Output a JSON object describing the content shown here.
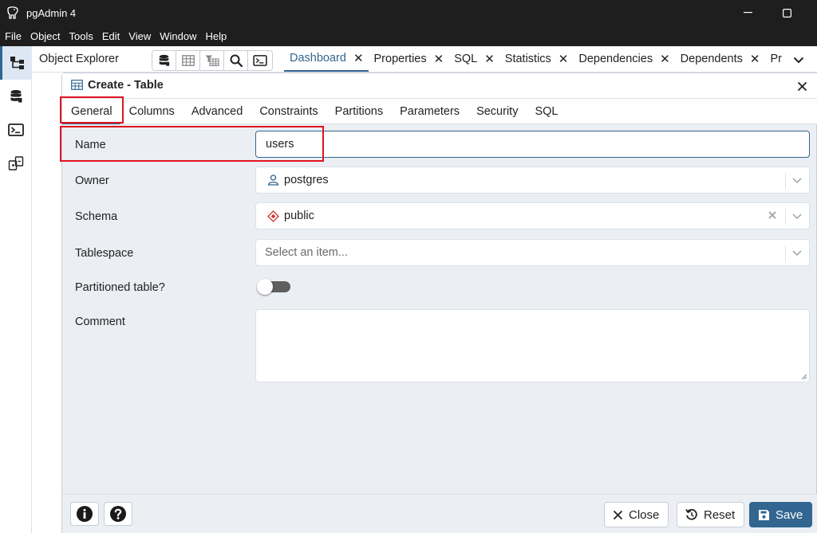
{
  "window": {
    "title": "pgAdmin 4"
  },
  "menu": [
    "File",
    "Object",
    "Tools",
    "Edit",
    "View",
    "Window",
    "Help"
  ],
  "object_explorer": {
    "label": "Object Explorer"
  },
  "tabs": [
    {
      "label": "Dashboard",
      "active": true
    },
    {
      "label": "Properties"
    },
    {
      "label": "SQL"
    },
    {
      "label": "Statistics"
    },
    {
      "label": "Dependencies"
    },
    {
      "label": "Dependents"
    },
    {
      "label": "Pr"
    }
  ],
  "dialog": {
    "title": "Create - Table",
    "tabs": [
      "General",
      "Columns",
      "Advanced",
      "Constraints",
      "Partitions",
      "Parameters",
      "Security",
      "SQL"
    ],
    "active_tab": "General",
    "fields": {
      "name": {
        "label": "Name",
        "value": "users"
      },
      "owner": {
        "label": "Owner",
        "value": "postgres"
      },
      "schema": {
        "label": "Schema",
        "value": "public"
      },
      "tablespace": {
        "label": "Tablespace",
        "placeholder": "Select an item..."
      },
      "partitioned": {
        "label": "Partitioned table?",
        "value": false
      },
      "comment": {
        "label": "Comment",
        "value": ""
      }
    },
    "buttons": {
      "close": "Close",
      "reset": "Reset",
      "save": "Save"
    }
  },
  "colors": {
    "accent": "#326690",
    "highlight": "#e0141e",
    "titlebar": "#1e1e1e",
    "dialog_bg": "#ebeef3"
  },
  "icons": {
    "app": "elephant-icon",
    "minimize": "minimize-icon",
    "maximize": "maximize-icon",
    "object_explorer": "tree-icon",
    "query_tool": "database-icon",
    "psql": "terminal-icon",
    "schema_diff": "diff-icon",
    "toolbar": [
      "database-icon",
      "table-icon",
      "filter-table-icon",
      "search-icon",
      "terminal-icon"
    ],
    "info": "info-icon",
    "help": "help-icon"
  }
}
